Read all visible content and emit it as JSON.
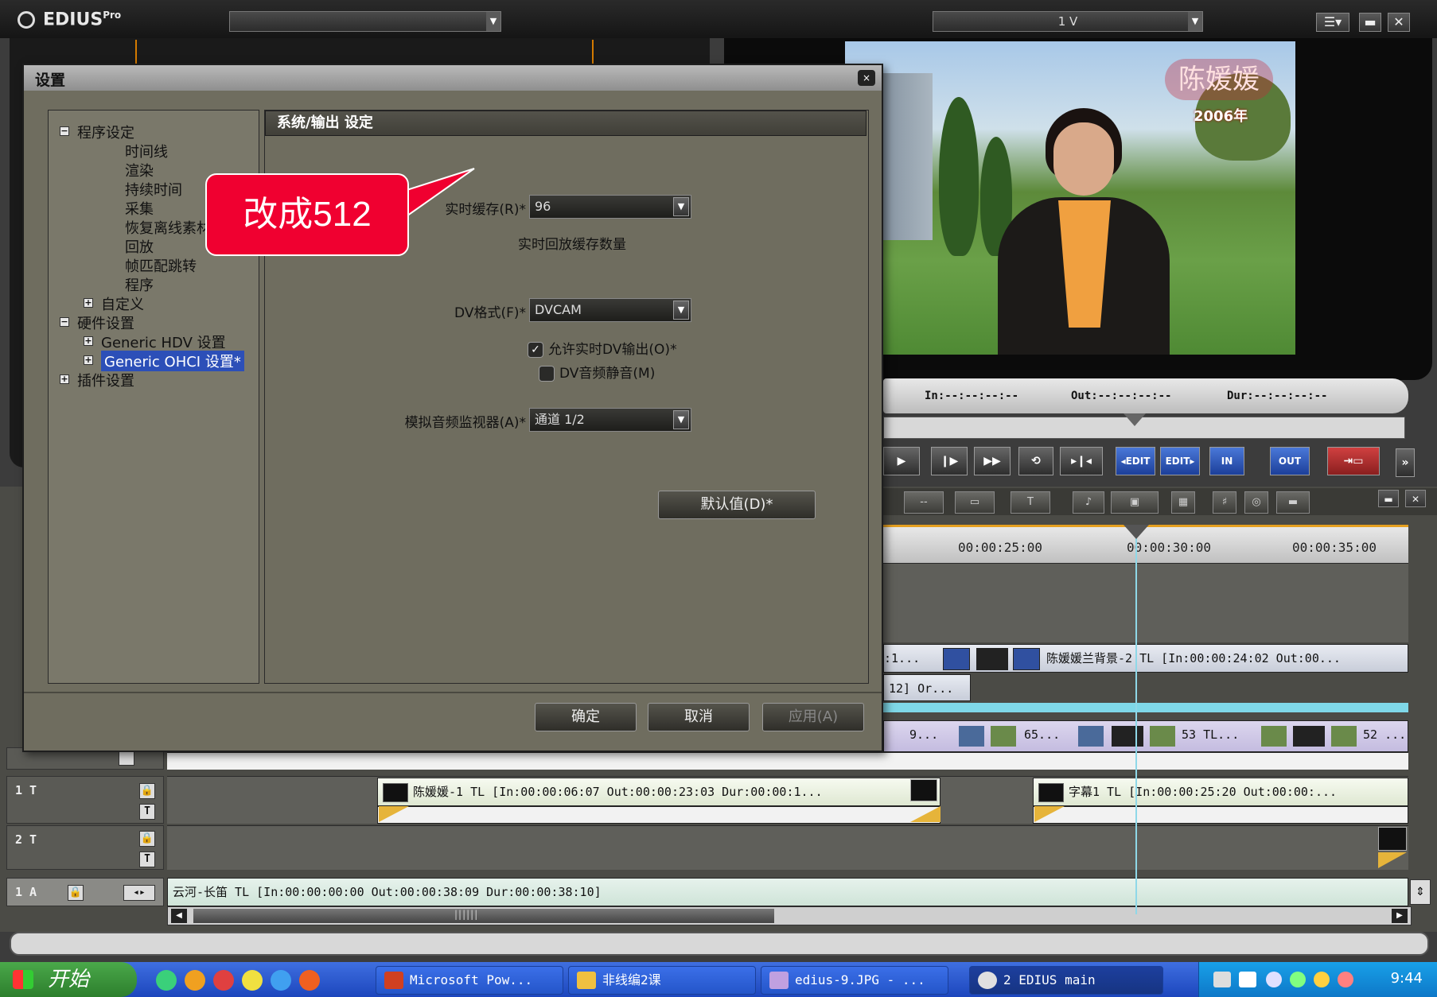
{
  "edius": {
    "logo": "EDIUS",
    "logo_sup": "Pro",
    "top_combo_right": "1 V"
  },
  "video": {
    "name_overlay": "陈媛媛",
    "year_overlay": "2006年"
  },
  "timecodes": {
    "in_label": "In",
    "in_value": "--:--:--:--",
    "out_label": "Out",
    "out_value": "--:--:--:--",
    "dur_label": "Dur",
    "dur_value": "--:--:--:--"
  },
  "transport": {
    "edit_left": "◂EDIT",
    "edit_right": "EDIT▸",
    "in": "IN",
    "out": "OUT"
  },
  "ruler": {
    "ticks": [
      "00:00:25:00",
      "00:00:30:00",
      "00:00:35:00"
    ]
  },
  "tracks": {
    "v2_clip_1": ":1...",
    "v2_clip_2": "陈媛媛兰背景-2 TL [In:00:00:24:02 Out:00...",
    "v2_clip_3": "12] Or...",
    "v1_clip_a": "9...",
    "v1_clip_b": "65...",
    "v1_clip_c": "53 TL...",
    "v1_clip_d": "52 ...",
    "t1_label": "1 T",
    "t1_clip_1": "陈媛媛-1 TL [In:00:00:06:07 Out:00:00:23:03 Dur:00:00:1...",
    "t1_clip_2": "字幕1 TL [In:00:00:25:20 Out:00:00:...",
    "t2_label": "2 T",
    "a1_label": "1 A",
    "a1_clip": "云河-长笛 TL [In:00:00:00:00 Out:00:00:38:09 Dur:00:00:38:10]"
  },
  "dialog": {
    "title": "设置",
    "close": "×",
    "tree": [
      {
        "label": "程序设定",
        "box": "−"
      },
      {
        "label": "时间线"
      },
      {
        "label": "渲染"
      },
      {
        "label": "持续时间"
      },
      {
        "label": "采集"
      },
      {
        "label": "恢复离线素材"
      },
      {
        "label": "回放"
      },
      {
        "label": "帧匹配跳转"
      },
      {
        "label": "程序"
      },
      {
        "label": "自定义",
        "box": "+"
      },
      {
        "label": "硬件设置",
        "box": "−"
      },
      {
        "label": "Generic HDV 设置",
        "box": "+"
      },
      {
        "label": "Generic OHCI 设置*",
        "box": "+",
        "selected": true
      },
      {
        "label": "插件设置",
        "box": "+"
      }
    ],
    "section_header": "系统/输出 设定",
    "realtime_cache_label": "实时缓存(R)*",
    "realtime_cache_value": "96",
    "realtime_cache_note": "实时回放缓存数量",
    "dv_format_label": "DV格式(F)*",
    "dv_format_value": "DVCAM",
    "allow_dv_output_label": "允许实时DV输出(O)*",
    "allow_dv_output_checked": true,
    "dv_audio_mute_label": "DV音频静音(M)",
    "dv_audio_mute_checked": false,
    "analog_monitor_label": "模拟音频监视器(A)*",
    "analog_monitor_value": "通道 1/2",
    "default_button": "默认值(D)*",
    "ok_button": "确定",
    "cancel_button": "取消",
    "apply_button": "应用(A)"
  },
  "callout": {
    "text": "改成512"
  },
  "taskbar": {
    "start": "开始",
    "tasks": [
      "Microsoft Pow...",
      "非线编2课",
      "edius-9.JPG - ...",
      "2 EDIUS main"
    ],
    "clock": "9:44"
  }
}
